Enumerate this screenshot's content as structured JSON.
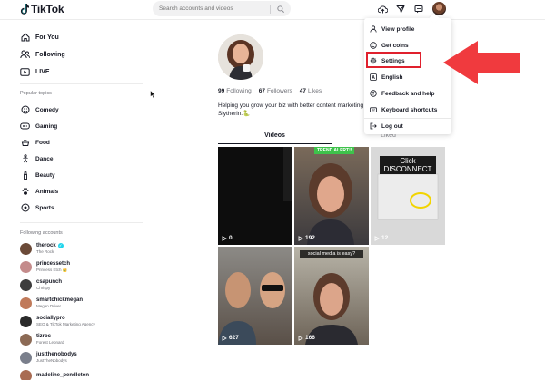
{
  "app": {
    "logo_text": "TikTok"
  },
  "search": {
    "placeholder": "Search accounts and videos"
  },
  "header_icons": [
    "upload-icon",
    "inbox-send-icon",
    "messages-icon"
  ],
  "sidebar": {
    "nav": [
      {
        "label": "For You",
        "icon": "home-icon"
      },
      {
        "label": "Following",
        "icon": "people-icon"
      },
      {
        "label": "LIVE",
        "icon": "live-icon"
      }
    ],
    "popular_topics_label": "Popular topics",
    "topics": [
      {
        "label": "Comedy",
        "icon": "comedy-icon"
      },
      {
        "label": "Gaming",
        "icon": "gaming-icon"
      },
      {
        "label": "Food",
        "icon": "food-icon"
      },
      {
        "label": "Dance",
        "icon": "dance-icon"
      },
      {
        "label": "Beauty",
        "icon": "beauty-icon"
      },
      {
        "label": "Animals",
        "icon": "animals-icon"
      },
      {
        "label": "Sports",
        "icon": "sports-icon"
      }
    ],
    "following_accounts_label": "Following accounts",
    "accounts": [
      {
        "name": "therock",
        "sub": "The Rock",
        "verified": true,
        "color": "#6b4a38"
      },
      {
        "name": "princessetch",
        "sub": "Princess Etch 👑",
        "verified": false,
        "color": "#c48b8b"
      },
      {
        "name": "csapunch",
        "sub": "Chrispy",
        "verified": false,
        "color": "#3d3d3d"
      },
      {
        "name": "smartchickmegan",
        "sub": "Megan Driver",
        "verified": false,
        "color": "#c07a5a"
      },
      {
        "name": "sociallypro",
        "sub": "SEO & TikTok Marketing Agency",
        "verified": false,
        "color": "#2b2b2b"
      },
      {
        "name": "tizroc",
        "sub": "Forest Leonard",
        "verified": false,
        "color": "#8c6a55"
      },
      {
        "name": "justthenobodys",
        "sub": "JustTheNobodys",
        "verified": false,
        "color": "#7a7f8c"
      },
      {
        "name": "madeline_pendleton",
        "sub": "",
        "verified": false,
        "color": "#a86b52"
      }
    ]
  },
  "profile": {
    "following_count": "99",
    "following_label": "Following",
    "followers_count": "67",
    "followers_label": "Followers",
    "likes_count": "47",
    "likes_label": "Likes",
    "bio_line1": "Helping you grow your biz with better content marketing",
    "bio_line2": "Slytherin.🐍",
    "tabs": {
      "videos": "Videos",
      "liked": "Liked"
    }
  },
  "videos": [
    {
      "views": "0",
      "overlay": ""
    },
    {
      "views": "192",
      "overlay": "TREND ALERT!!"
    },
    {
      "views": "12",
      "overlay": "Click DISCONNECT"
    },
    {
      "views": "627",
      "overlay": ""
    },
    {
      "views": "166",
      "overlay": "social media is easy?"
    }
  ],
  "dropdown": {
    "items": [
      {
        "label": "View profile",
        "icon": "user-icon"
      },
      {
        "label": "Get coins",
        "icon": "coin-icon"
      },
      {
        "label": "Settings",
        "icon": "gear-icon"
      },
      {
        "label": "English",
        "icon": "language-icon"
      },
      {
        "label": "Feedback and help",
        "icon": "help-icon"
      },
      {
        "label": "Keyboard shortcuts",
        "icon": "keyboard-icon"
      },
      {
        "label": "Log out",
        "icon": "logout-icon"
      }
    ]
  },
  "colors": {
    "accent_red": "#fe2c55",
    "annotation_red": "#e0202d",
    "verified_blue": "#20d5ec",
    "text_primary": "#161823"
  }
}
